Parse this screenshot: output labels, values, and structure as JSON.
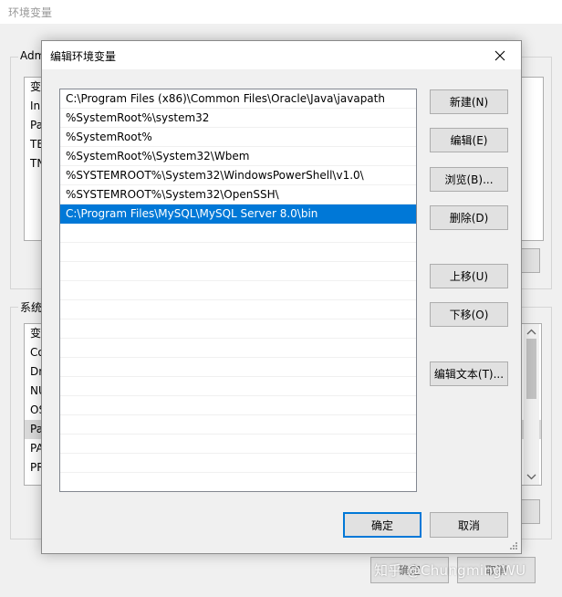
{
  "background_window": {
    "title": "环境变量",
    "user_group_label": "Adm",
    "user_rows": [
      "变",
      "In",
      "Pa",
      "TE",
      "TN"
    ],
    "system_group_label": "系统",
    "system_rows": [
      "变",
      "Co",
      "Dr",
      "NU",
      "OS",
      "Pa",
      "PA",
      "PR"
    ],
    "ok_label": "确定",
    "cancel_label": "取消"
  },
  "dialog": {
    "title": "编辑环境变量",
    "paths": [
      "C:\\Program Files (x86)\\Common Files\\Oracle\\Java\\javapath",
      "%SystemRoot%\\system32",
      "%SystemRoot%",
      "%SystemRoot%\\System32\\Wbem",
      "%SYSTEMROOT%\\System32\\WindowsPowerShell\\v1.0\\",
      "%SYSTEMROOT%\\System32\\OpenSSH\\",
      "C:\\Program Files\\MySQL\\MySQL Server 8.0\\bin"
    ],
    "selected_index": 6,
    "empty_rows": 14,
    "buttons": {
      "new": "新建(N)",
      "edit": "编辑(E)",
      "browse": "浏览(B)...",
      "delete": "删除(D)",
      "move_up": "上移(U)",
      "move_down": "下移(O)",
      "edit_text": "编辑文本(T)..."
    },
    "ok": "确定",
    "cancel": "取消"
  },
  "watermark": "知乎 @ChungmingWU",
  "colors": {
    "selection": "#0078d7",
    "dialog_bg": "#f0f0f0",
    "button_bg": "#e1e1e1"
  }
}
